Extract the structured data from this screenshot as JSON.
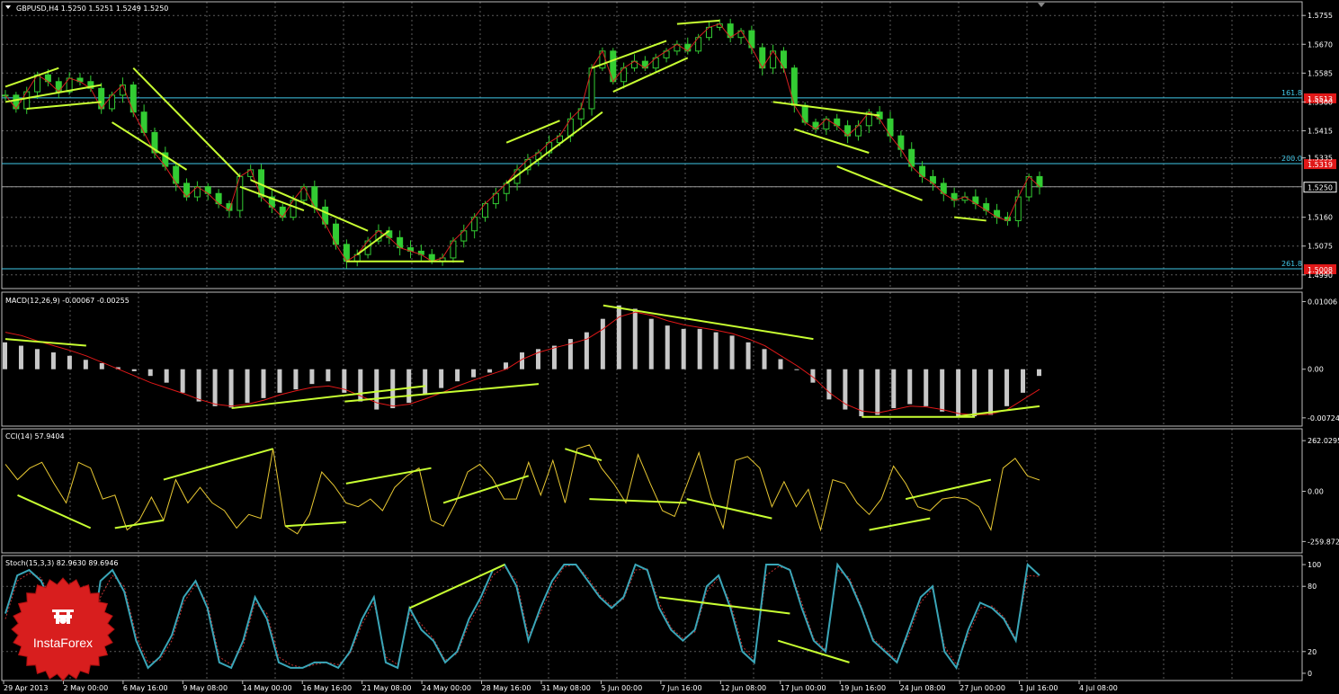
{
  "colors": {
    "bg": "#000000",
    "grid": "#5a5a5a",
    "border": "#bdbdbd",
    "bull": "#33cc33",
    "bear": "#33cc33",
    "trend": "#c8ff32",
    "ma": "#d62020",
    "level": "#41c8e8",
    "hist": "#c8c8c8",
    "signal": "#e01818",
    "cci": "#e8c832",
    "stoch_main": "#3aa6b8",
    "stoch_signal": "#c03030",
    "tag_red": "#e01818",
    "logo": "#d81e1e"
  },
  "chart_data": [
    {
      "type": "candlestick",
      "title": "GBPUSD,H4  1.5250 1.5251 1.5249 1.5250",
      "symbol": "GBPUSD",
      "timeframe": "H4",
      "ohlc": {
        "open": 1.525,
        "high": 1.5251,
        "low": 1.5249,
        "close": 1.525
      },
      "y_ticks": [
        "1.5755",
        "1.5670",
        "1.5585",
        "1.5500",
        "1.5415",
        "1.5335",
        "1.5250",
        "1.5160",
        "1.5075",
        "1.4990"
      ],
      "ylim": [
        1.4955,
        1.579
      ],
      "current_price": "1.5250",
      "levels": [
        {
          "label": "161.8",
          "value": 1.5512,
          "tag": "1.5513"
        },
        {
          "label": "200.0",
          "value": 1.5318,
          "tag": "1.5319"
        },
        {
          "label": "261.8",
          "value": 1.5008,
          "tag": "1.5008"
        }
      ],
      "close_series": [
        1.552,
        1.548,
        1.553,
        1.558,
        1.556,
        1.553,
        1.557,
        1.556,
        1.554,
        1.548,
        1.552,
        1.555,
        1.547,
        1.541,
        1.535,
        1.531,
        1.526,
        1.522,
        1.525,
        1.523,
        1.52,
        1.518,
        1.528,
        1.53,
        1.522,
        1.519,
        1.516,
        1.521,
        1.525,
        1.519,
        1.514,
        1.508,
        1.503,
        1.505,
        1.509,
        1.512,
        1.51,
        1.507,
        1.506,
        1.505,
        1.503,
        1.504,
        1.509,
        1.512,
        1.516,
        1.52,
        1.523,
        1.526,
        1.53,
        1.533,
        1.535,
        1.538,
        1.54,
        1.545,
        1.548,
        1.56,
        1.565,
        1.556,
        1.56,
        1.562,
        1.56,
        1.563,
        1.565,
        1.567,
        1.565,
        1.569,
        1.572,
        1.573,
        1.569,
        1.571,
        1.566,
        1.56,
        1.565,
        1.56,
        1.549,
        1.544,
        1.542,
        1.545,
        1.543,
        1.54,
        1.543,
        1.547,
        1.545,
        1.54,
        1.536,
        1.531,
        1.528,
        1.526,
        1.523,
        1.521,
        1.522,
        1.52,
        1.518,
        1.516,
        1.515,
        1.522,
        1.528,
        1.525
      ]
    },
    {
      "type": "bar",
      "name": "MACD(12,26,9)",
      "label": "MACD(12,26,9) -0.00067 -0.00255",
      "y_ticks": [
        "0.01006",
        "0.00",
        "-0.00724"
      ],
      "ylim": [
        -0.0082,
        0.0108
      ],
      "hist": [
        0.004,
        0.0035,
        0.003,
        0.0025,
        0.002,
        0.0014,
        0.0009,
        0.0003,
        -0.0003,
        -0.001,
        -0.002,
        -0.0035,
        -0.0048,
        -0.0055,
        -0.0057,
        -0.005,
        -0.0043,
        -0.0035,
        -0.003,
        -0.0022,
        -0.0018,
        -0.0035,
        -0.0048,
        -0.006,
        -0.0058,
        -0.005,
        -0.0038,
        -0.0028,
        -0.0018,
        -0.0012,
        -0.0005,
        0.001,
        0.0025,
        0.003,
        0.0035,
        0.0045,
        0.0055,
        0.0075,
        0.0095,
        0.009,
        0.0075,
        0.0065,
        0.006,
        0.006,
        0.0055,
        0.005,
        0.004,
        0.003,
        0.0015,
        0.0,
        -0.002,
        -0.0045,
        -0.006,
        -0.007,
        -0.0068,
        -0.0058,
        -0.0052,
        -0.0055,
        -0.0063,
        -0.007,
        -0.007,
        -0.0068,
        -0.0055,
        -0.0035,
        -0.001
      ],
      "signal": [
        0.0055,
        0.005,
        0.0042,
        0.0035,
        0.0028,
        0.002,
        0.001,
        0.0,
        -0.001,
        -0.002,
        -0.0028,
        -0.0036,
        -0.0045,
        -0.0052,
        -0.0055,
        -0.0052,
        -0.0046,
        -0.0038,
        -0.0032,
        -0.0027,
        -0.0025,
        -0.003,
        -0.004,
        -0.005,
        -0.0055,
        -0.0052,
        -0.0044,
        -0.0035,
        -0.0025,
        -0.0016,
        -0.0008,
        0.0,
        0.0015,
        0.0025,
        0.0032,
        0.0038,
        0.0045,
        0.006,
        0.0078,
        0.0085,
        0.008,
        0.0072,
        0.0066,
        0.0062,
        0.0058,
        0.0053,
        0.0045,
        0.0035,
        0.002,
        0.0005,
        -0.0012,
        -0.0035,
        -0.0052,
        -0.0062,
        -0.0065,
        -0.006,
        -0.0055,
        -0.0056,
        -0.006,
        -0.0066,
        -0.0068,
        -0.0067,
        -0.006,
        -0.0045,
        -0.003
      ]
    },
    {
      "type": "line",
      "name": "CCI(14)",
      "label": "CCI(14) 57.9404",
      "y_ticks": [
        "262.0295",
        "0.00",
        "-259.8726"
      ],
      "ylim": [
        -300,
        300
      ],
      "values": [
        140,
        60,
        120,
        150,
        40,
        -60,
        150,
        120,
        -40,
        -20,
        -200,
        -150,
        -30,
        -150,
        60,
        -60,
        20,
        -60,
        -100,
        -190,
        -120,
        -140,
        220,
        -180,
        -220,
        -120,
        100,
        30,
        -60,
        -80,
        -40,
        -100,
        20,
        80,
        120,
        -150,
        -180,
        -60,
        100,
        140,
        70,
        -40,
        -40,
        150,
        -20,
        160,
        -60,
        220,
        240,
        120,
        40,
        -60,
        190,
        40,
        -100,
        -130,
        30,
        200,
        -30,
        -190,
        160,
        180,
        120,
        -80,
        50,
        -80,
        10,
        -200,
        60,
        40,
        -60,
        -120,
        -40,
        130,
        40,
        -80,
        -100,
        -40,
        -30,
        -40,
        -80,
        -200,
        120,
        170,
        80,
        58
      ]
    },
    {
      "type": "line",
      "name": "Stoch(15,3,3)",
      "label": "Stoch(15,3,3) 82.9630 89.6946",
      "y_ticks": [
        "100",
        "80",
        "20",
        "0"
      ],
      "ylim": [
        -5,
        105
      ],
      "main": [
        55,
        90,
        95,
        85,
        60,
        35,
        20,
        10,
        85,
        95,
        75,
        30,
        5,
        15,
        35,
        70,
        85,
        60,
        10,
        5,
        30,
        70,
        50,
        10,
        5,
        5,
        10,
        10,
        5,
        20,
        50,
        70,
        10,
        5,
        60,
        40,
        30,
        10,
        20,
        50,
        70,
        95,
        100,
        80,
        30,
        60,
        85,
        100,
        100,
        85,
        70,
        60,
        70,
        100,
        95,
        60,
        40,
        30,
        40,
        80,
        90,
        60,
        20,
        10,
        100,
        100,
        95,
        60,
        30,
        20,
        100,
        85,
        60,
        30,
        20,
        10,
        40,
        70,
        80,
        20,
        5,
        40,
        65,
        60,
        50,
        30,
        100,
        90
      ],
      "signal": [
        50,
        85,
        92,
        88,
        65,
        40,
        22,
        12,
        70,
        90,
        80,
        35,
        10,
        12,
        30,
        65,
        82,
        65,
        15,
        8,
        25,
        65,
        55,
        15,
        8,
        5,
        8,
        10,
        8,
        18,
        45,
        65,
        15,
        8,
        55,
        45,
        32,
        12,
        18,
        45,
        65,
        90,
        98,
        85,
        35,
        55,
        80,
        98,
        100,
        88,
        72,
        62,
        68,
        95,
        96,
        65,
        42,
        32,
        38,
        75,
        88,
        65,
        25,
        12,
        90,
        98,
        96,
        65,
        32,
        22,
        95,
        88,
        62,
        32,
        22,
        12,
        35,
        65,
        78,
        25,
        8,
        35,
        60,
        62,
        52,
        32,
        90,
        89
      ]
    }
  ],
  "time_axis": [
    "29 Apr 2013",
    "2 May 00:00",
    "6 May 16:00",
    "9 May 08:00",
    "14 May 00:00",
    "16 May 16:00",
    "21 May 08:00",
    "24 May 00:00",
    "28 May 16:00",
    "31 May 08:00",
    "5 Jun 00:00",
    "7 Jun 16:00",
    "12 Jun 08:00",
    "17 Jun 00:00",
    "19 Jun 16:00",
    "24 Jun 08:00",
    "27 Jun 00:00",
    "1 Jul 16:00",
    "4 Jul 08:00"
  ],
  "logo": {
    "text": "InstaForex"
  }
}
